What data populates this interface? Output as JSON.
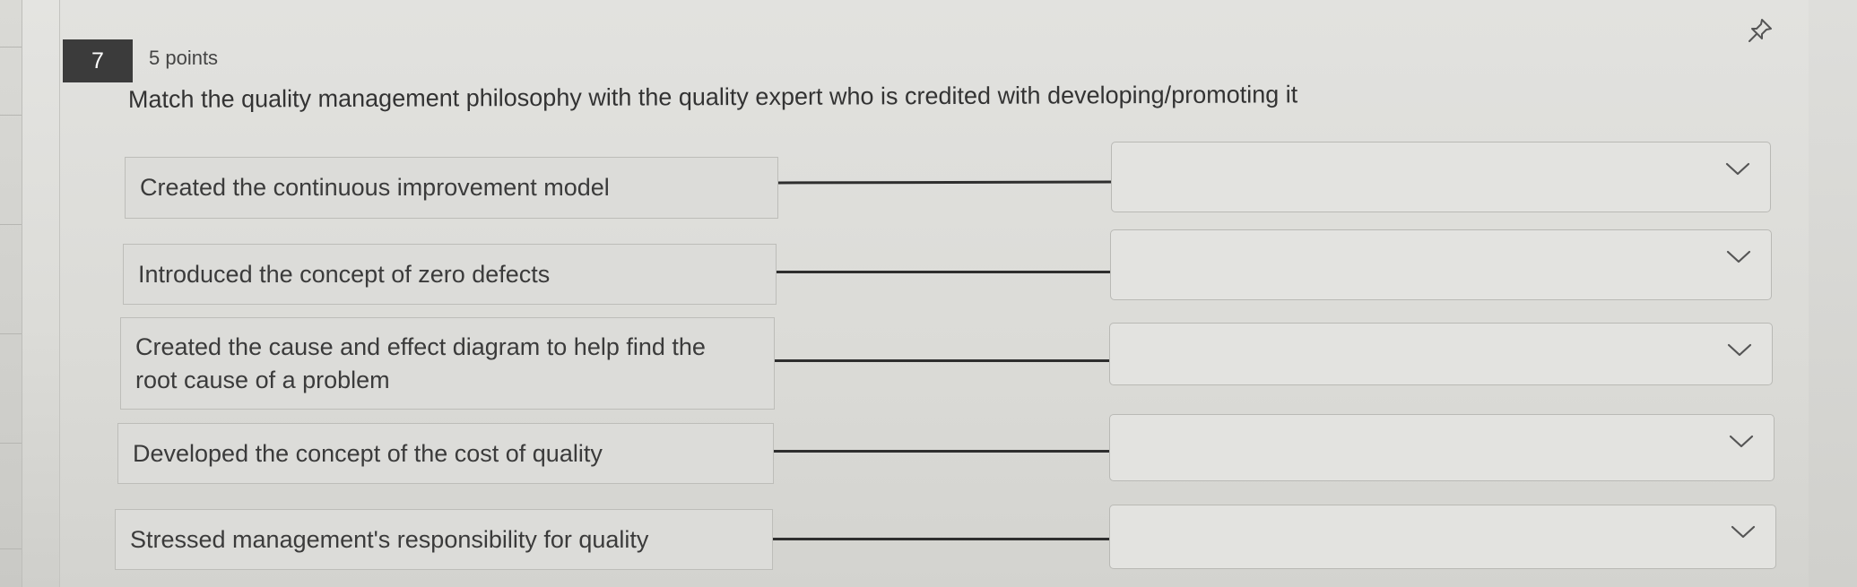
{
  "question": {
    "number": "7",
    "points": "5 points",
    "text": "Match the quality management philosophy with the quality expert who is credited with developing/promoting it",
    "pin_icon": "pin-icon"
  },
  "matches": [
    {
      "prompt": "Created the continuous improvement model",
      "selected": ""
    },
    {
      "prompt": "Introduced the concept of zero defects",
      "selected": ""
    },
    {
      "prompt_line1": "Created the cause and effect diagram to help find the",
      "prompt_line2": "root cause of a problem",
      "selected": ""
    },
    {
      "prompt": "Developed the concept of the cost of quality",
      "selected": ""
    },
    {
      "prompt": "Stressed management's responsibility for quality",
      "selected": ""
    }
  ],
  "icons": {
    "dropdown": "chevron-down-icon"
  },
  "colors": {
    "number_badge": "#3b3b3b",
    "background": "#dcdcd8",
    "connector": "#2e2e2e"
  }
}
